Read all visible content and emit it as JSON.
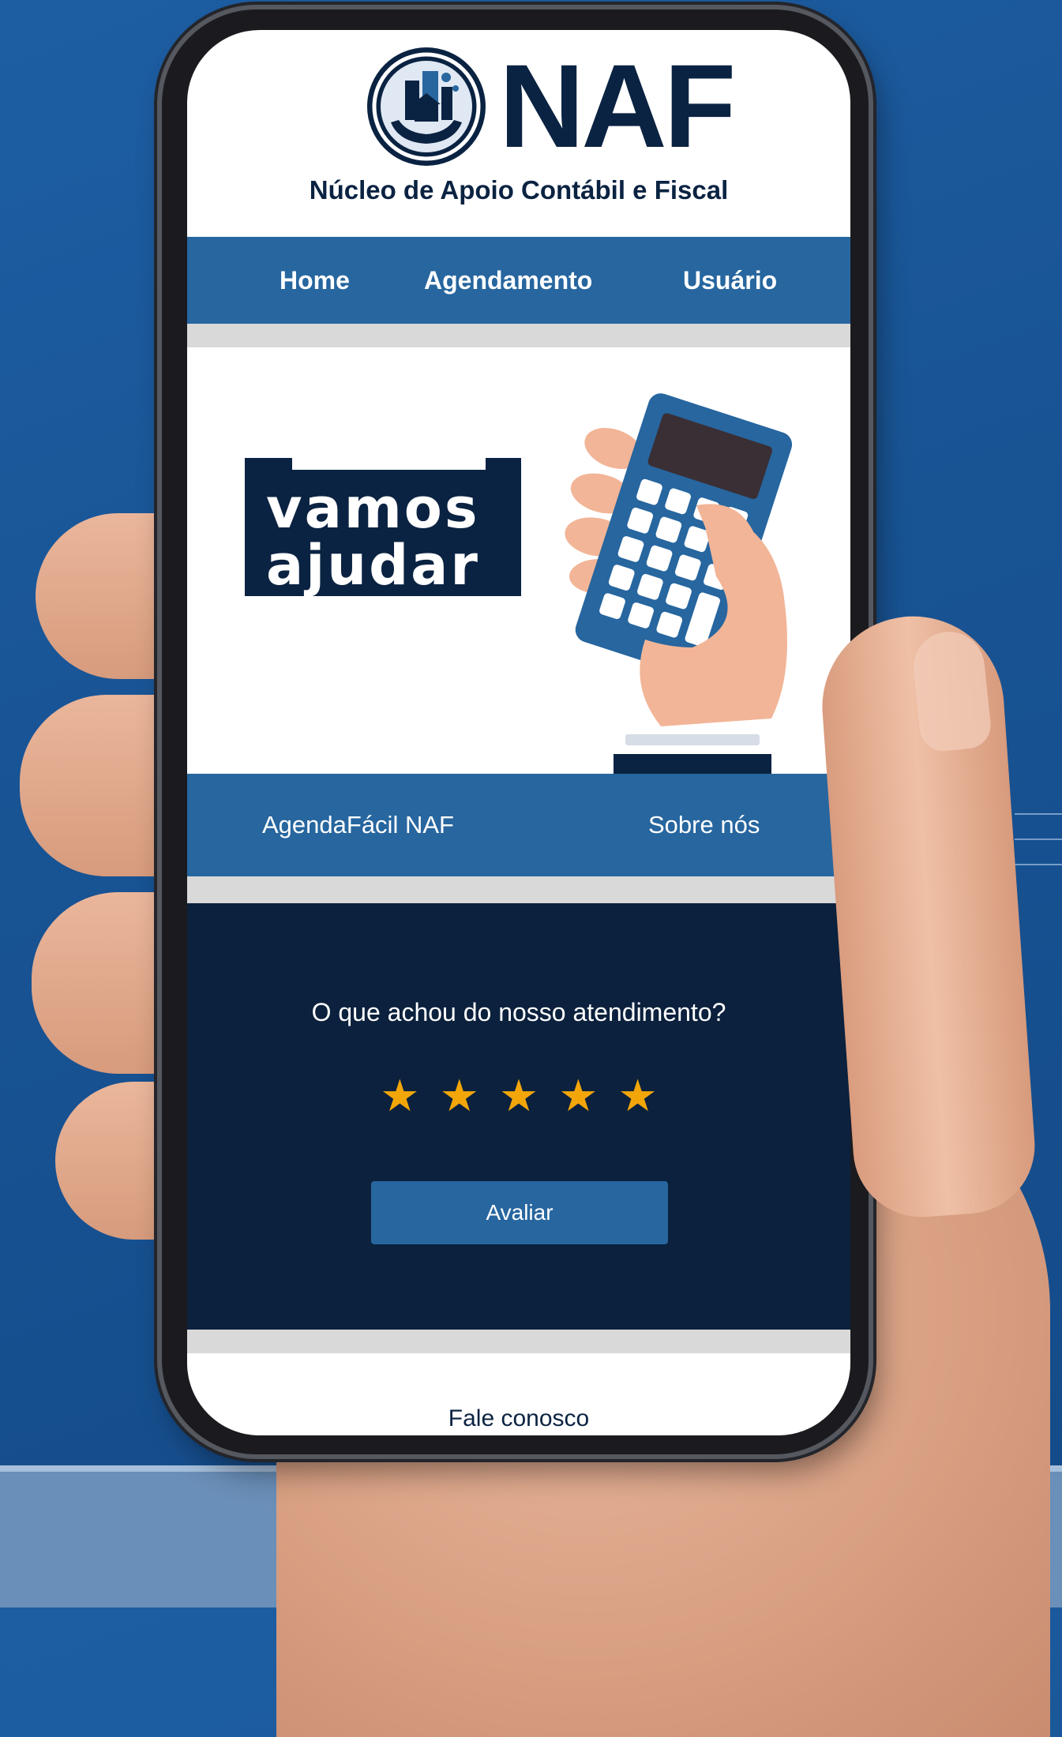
{
  "brand": {
    "wordmark": "NAF",
    "subtitle": "Núcleo de Apoio Contábil e Fiscal"
  },
  "nav": {
    "items": [
      {
        "label": "Home"
      },
      {
        "label": "Agendamento"
      },
      {
        "label": "Usuário"
      }
    ]
  },
  "hero": {
    "line1": "vamos",
    "line2": "ajudar"
  },
  "banner": {
    "left": "AgendaFácil NAF",
    "right": "Sobre nós"
  },
  "feedback": {
    "question": "O que achou do nosso atendimento?",
    "stars_total": 5,
    "star_glyph": "★",
    "button_label": "Avaliar"
  },
  "footer": {
    "label": "Fale conosco"
  },
  "colors": {
    "primary": "#27669f",
    "navy": "#0b213d",
    "star": "#f2a60a"
  }
}
